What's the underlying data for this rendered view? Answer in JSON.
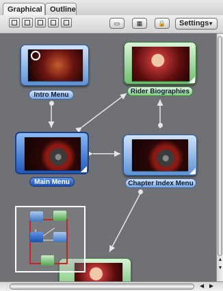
{
  "tabs": [
    {
      "label": "Graphical",
      "active": true
    },
    {
      "label": "Outline",
      "active": false
    }
  ],
  "toolbar": {
    "view_icons": [
      "grid-view-icon",
      "list-view-icon",
      "film-strip-icon",
      "menu-view-icon",
      "track-view-icon"
    ],
    "right_icons": [
      "screen-icon",
      "film-icon",
      "lock-icon"
    ],
    "settings_label": "Settings"
  },
  "nodes": [
    {
      "id": "intro",
      "label": "Intro Menu",
      "style": "blue"
    },
    {
      "id": "rider",
      "label": "Rider Biographies",
      "style": "green"
    },
    {
      "id": "main",
      "label": "Main Menu",
      "style": "selected"
    },
    {
      "id": "chapter",
      "label": "Chapter Index Menu",
      "style": "blue"
    }
  ],
  "colors": {
    "canvas": "#6f7176",
    "blue_node": "#5d93d4",
    "green_node": "#6fc06f",
    "selected_node": "#2358b8",
    "navigator_frame": "#cc2222"
  }
}
